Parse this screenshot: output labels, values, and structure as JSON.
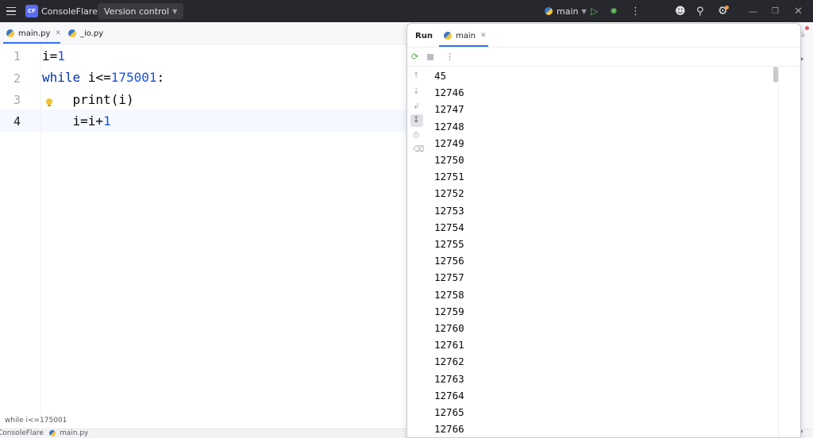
{
  "titlebar": {
    "project_badge": "CF",
    "project_name": "ConsoleFlare",
    "version_control": "Version control",
    "run_config": "main"
  },
  "editor_tabs": [
    {
      "label": "main.py",
      "active": true
    },
    {
      "label": "_io.py",
      "active": false
    }
  ],
  "editor": {
    "line_numbers": [
      "1",
      "2",
      "3",
      "4"
    ],
    "lines": [
      [
        {
          "t": "i=",
          "c": ""
        },
        {
          "t": "1",
          "c": "num"
        }
      ],
      [
        {
          "t": "while",
          "c": "kw"
        },
        {
          "t": " i<=",
          "c": ""
        },
        {
          "t": "175001",
          "c": "num"
        },
        {
          "t": ":",
          "c": ""
        }
      ],
      [
        {
          "t": "    print(i)",
          "c": ""
        }
      ],
      [
        {
          "t": "    i=i+",
          "c": ""
        },
        {
          "t": "1",
          "c": "num"
        }
      ]
    ]
  },
  "breadcrumb_hint": "while i<=175001",
  "statusbar": {
    "project": "ConsoleFlare",
    "file": "main.py"
  },
  "run_panel": {
    "title": "Run",
    "tab_label": "main",
    "output": [
      "45",
      "12746",
      "12747",
      "12748",
      "12749",
      "12750",
      "12751",
      "12752",
      "12753",
      "12754",
      "12755",
      "12756",
      "12757",
      "12758",
      "12759",
      "12760",
      "12761",
      "12762",
      "12763",
      "12764",
      "12765",
      "12766"
    ]
  },
  "colors": {
    "accent": "#3574f0",
    "keyword": "#0033b3",
    "number": "#1750eb",
    "run_green": "#5fb85b"
  }
}
